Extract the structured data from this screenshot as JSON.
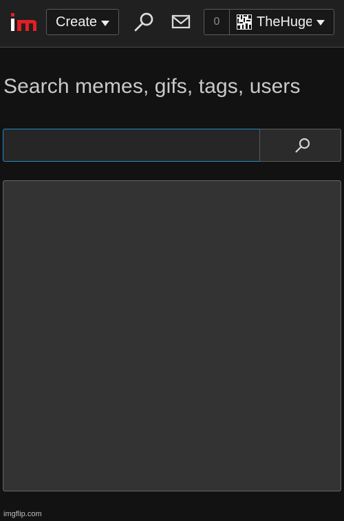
{
  "header": {
    "logo_text": "im",
    "create_label": "Create",
    "notification_count": "0",
    "username": "TheHuge",
    "brand_colors": {
      "accent": "#e41f25",
      "logo_i_dot": "#e41f25",
      "search_focus": "#218cc8"
    },
    "icons": {
      "logo": "imgflip-logo",
      "search": "search-icon",
      "mail": "mail-icon",
      "avatar": "avatar-pattern-icon",
      "dropdown": "chevron-down-icon"
    }
  },
  "search": {
    "heading": "Search memes, gifs, tags, users",
    "input_value": "",
    "input_placeholder": "",
    "submit_icon": "search-icon"
  },
  "footer": {
    "watermark": "imgflip.com"
  },
  "theme": {
    "background": "#121212",
    "topbar": "#202020",
    "panel": "#333333",
    "text": "#d9d9d9"
  }
}
